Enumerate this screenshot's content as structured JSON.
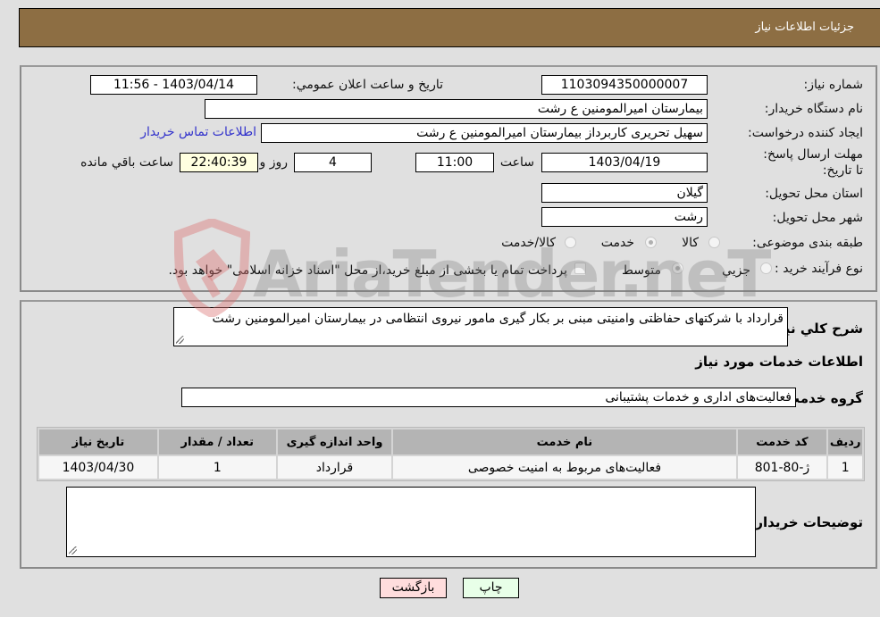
{
  "header": {
    "title": "جزئیات اطلاعات نیاز"
  },
  "form": {
    "need_number": {
      "label": "شماره نیاز:",
      "value": "1103094350000007"
    },
    "announce_datetime": {
      "label": "تاریخ و ساعت اعلان عمومي:",
      "value": "1403/04/14 - 11:56"
    },
    "buyer_org": {
      "label": "نام دستگاه خریدار:",
      "value": "بیمارستان امیرالمومنین ع  رشت"
    },
    "requester": {
      "label": "ایجاد کننده درخواست:",
      "value": "سهیل تحریری کاربرداز بیمارستان امیرالمومنین ع  رشت"
    },
    "buyer_contact_link": "اطلاعات تماس خریدار",
    "deadline": {
      "label": "مهلت ارسال پاسخ: تا تاریخ:",
      "date": "1403/04/19",
      "time_label": "ساعت",
      "time": "11:00",
      "days": "4",
      "days_label": "روز و",
      "remaining": "22:40:39",
      "remaining_label": "ساعت باقي مانده"
    },
    "province": {
      "label": "استان محل تحویل:",
      "value": "گیلان"
    },
    "city": {
      "label": "شهر محل تحویل:",
      "value": "رشت"
    },
    "category": {
      "label": "طبقه بندی موضوعی:",
      "options": [
        "کالا",
        "خدمت",
        "کالا/خدمت"
      ],
      "selected": "خدمت"
    },
    "process_type": {
      "label": "نوع فرآیند خرید :",
      "options": [
        "جزیي",
        "متوسط"
      ],
      "selected": "متوسط",
      "treasury_note": "پرداخت تمام یا بخشی از مبلغ خرید،از محل \"اسناد خزانه اسلامی\" خواهد بود.",
      "treasury_checked": false
    }
  },
  "details": {
    "description_label": "شرح کلي نیاز:",
    "description": "قرارداد با شرکتهای حفاظتی وامنیتی مبنی بر بکار گیری مامور نیروی انتظامی در بیمارستان امیرالمومنین رشت",
    "services_heading": "اطلاعات خدمات مورد نیاز",
    "service_group_label": "گروه خدمت:",
    "service_group": "فعالیت‌های اداری و خدمات پشتیبانی",
    "table": {
      "headers": [
        "ردیف",
        "کد خدمت",
        "نام خدمت",
        "واحد اندازه گیری",
        "تعداد / مقدار",
        "تاریخ نیاز"
      ],
      "rows": [
        [
          "1",
          "ژ-80-801",
          "فعالیت‌های مربوط به امنیت خصوصی",
          "قرارداد",
          "1",
          "1403/04/30"
        ]
      ]
    },
    "buyer_notes_label": "توضیحات خریدار:",
    "buyer_notes": ""
  },
  "buttons": {
    "back": "بازگشت",
    "print": "چاپ"
  },
  "watermark": {
    "text": "AriaTender.neT"
  },
  "colors": {
    "header_bg": "#8d6e43",
    "link": "#3333cc",
    "timer_bg": "#ffffe0",
    "back_bg": "#ffdddd",
    "print_bg": "#e8ffe8"
  }
}
